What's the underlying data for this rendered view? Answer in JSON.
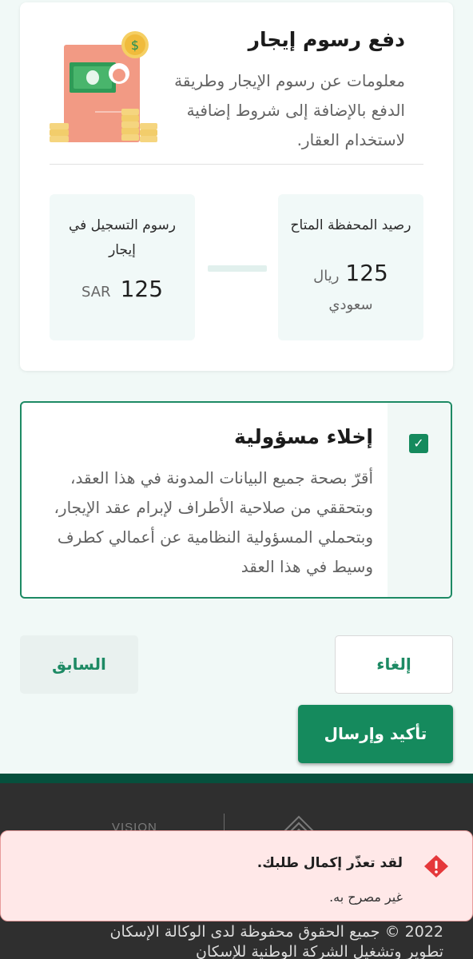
{
  "fee_card": {
    "title": "دفع رسوم إيجار",
    "description": "معلومات عن رسوم الإيجار وطريقة الدفع بالإضافة إلى شروط إضافية لاستخدام العقار.",
    "wallet": {
      "label": "رصيد المحفظة المتاح",
      "amount": "125",
      "currency_line1": "ريال",
      "currency_line2": "سعودي"
    },
    "registration_fee": {
      "label": "رسوم التسجيل في إيجار",
      "amount": "125",
      "currency": "SAR"
    }
  },
  "disclaimer": {
    "title": "إخلاء مسؤولية",
    "checked": true,
    "checkbox_glyph": "✓",
    "text": "أقرّ بصحة جميع البيانات المدونة في هذا العقد، وبتحققي من صلاحية الأطراف لإبرام عقد الإيجار، وبتحملي المسؤولية النظامية عن أعمالي كطرف وسيط في هذا العقد"
  },
  "buttons": {
    "previous": "السابق",
    "cancel": "إلغاء",
    "submit": "تأكيد وإرسال"
  },
  "footer": {
    "vision_text": "VISION",
    "copyright": "2022 © جميع الحقوق محفوظة لدى الوكالة الإسكان",
    "company": "تطوير وتشغيل الشركة الوطنية للإسكان"
  },
  "toast": {
    "title": "لقد تعذّر إكمال طلبك.",
    "message": "غير مصرح به."
  },
  "colors": {
    "accent": "#158a5d",
    "background": "#f1f9f7",
    "footer": "#2f2f2f",
    "toast_bg": "#ffe8e8",
    "error_icon": "#e5383b"
  },
  "icons": {
    "illustration": "invoice-money-icon",
    "checkbox": "check-icon",
    "toast": "error-diamond-icon",
    "ministry": "ministry-housing-logo"
  }
}
